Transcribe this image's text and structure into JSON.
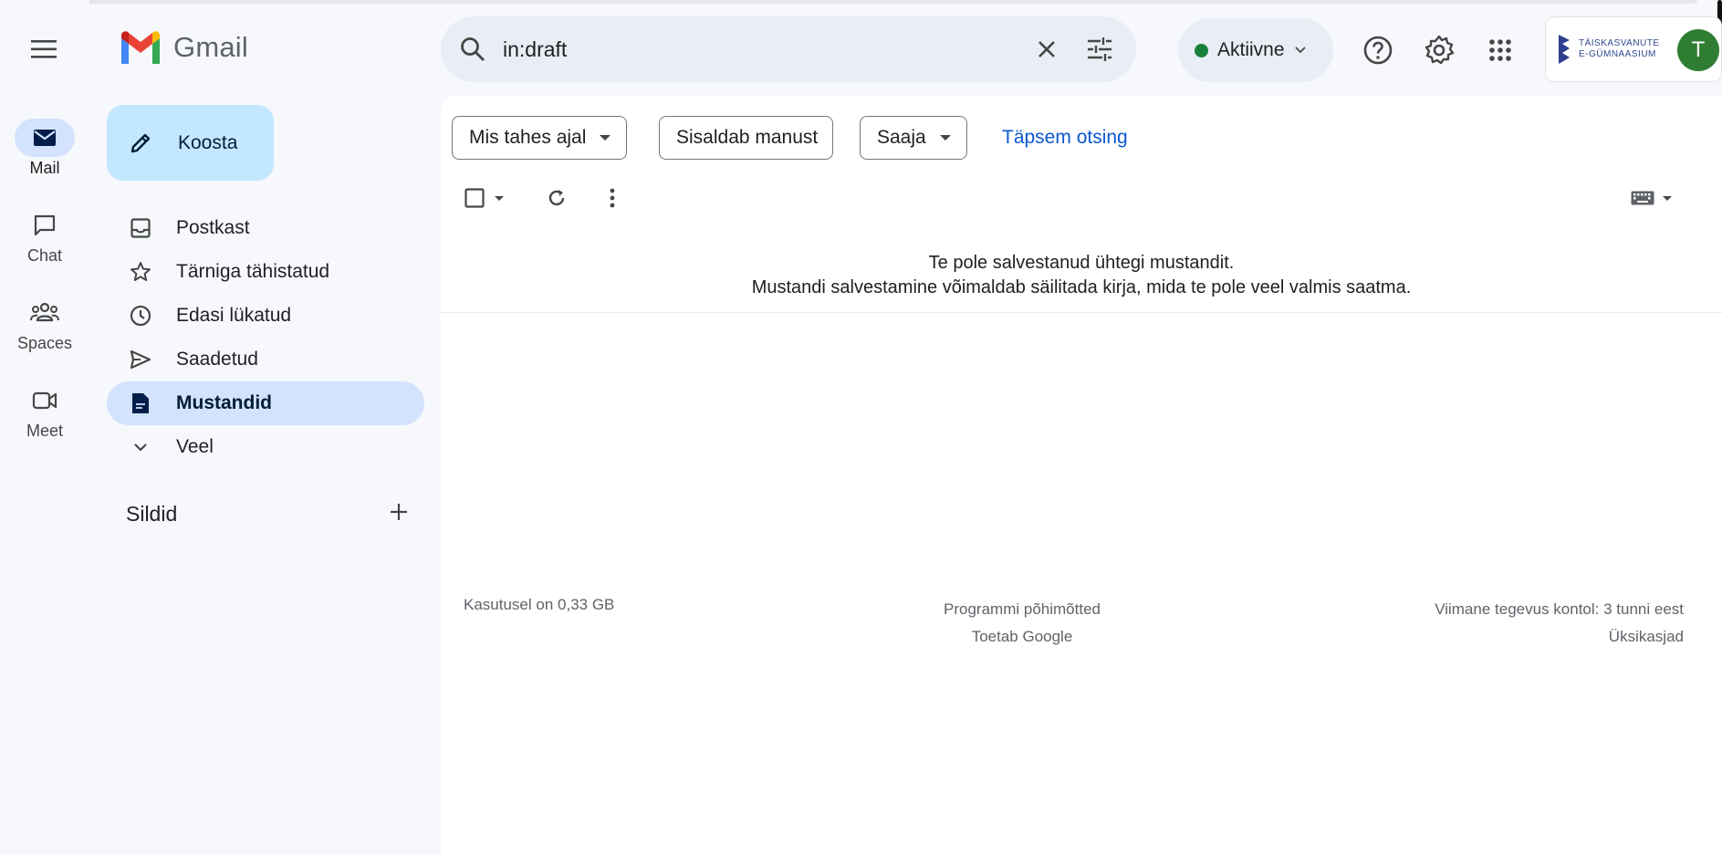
{
  "app": {
    "name": "Gmail"
  },
  "rail": {
    "items": [
      {
        "label": "Mail",
        "icon": "mail-icon",
        "active": true
      },
      {
        "label": "Chat",
        "icon": "chat-icon"
      },
      {
        "label": "Spaces",
        "icon": "spaces-icon"
      },
      {
        "label": "Meet",
        "icon": "meet-icon"
      }
    ]
  },
  "compose": {
    "label": "Koosta"
  },
  "nav": {
    "items": [
      {
        "label": "Postkast",
        "icon": "inbox-icon"
      },
      {
        "label": "Tärniga tähistatud",
        "icon": "star-icon"
      },
      {
        "label": "Edasi lükatud",
        "icon": "clock-icon"
      },
      {
        "label": "Saadetud",
        "icon": "send-icon"
      },
      {
        "label": "Mustandid",
        "icon": "draft-icon",
        "active": true
      },
      {
        "label": "Veel",
        "icon": "chevron-down-icon"
      }
    ]
  },
  "labels": {
    "title": "Sildid"
  },
  "search": {
    "value": "in:draft"
  },
  "status": {
    "label": "Aktiivne",
    "color": "#188038"
  },
  "account": {
    "org_line1": "TÄISKASVANUTE",
    "org_line2": "E-GÜMNAASIUM",
    "avatar_letter": "T",
    "avatar_color": "#2e7d32"
  },
  "filters": {
    "chips": [
      "Mis tahes ajal",
      "Sisaldab manust",
      "Saaja"
    ],
    "advanced": "Täpsem otsing"
  },
  "main": {
    "empty_line1": "Te pole salvestanud ühtegi mustandit.",
    "empty_line2": "Mustandi salvestamine võimaldab säilitada kirja, mida te pole veel valmis saatma."
  },
  "footer": {
    "storage": "Kasutusel on 0,33 GB",
    "policy": "Programmi põhimõtted",
    "powered": "Toetab Google",
    "activity": "Viimane tegevus kontol: 3 tunni eest",
    "details": "Üksikasjad"
  },
  "colors": {
    "accent": "#0b57d0",
    "compose_bg": "#c2e7ff",
    "active_bg": "#d3e3fd"
  }
}
